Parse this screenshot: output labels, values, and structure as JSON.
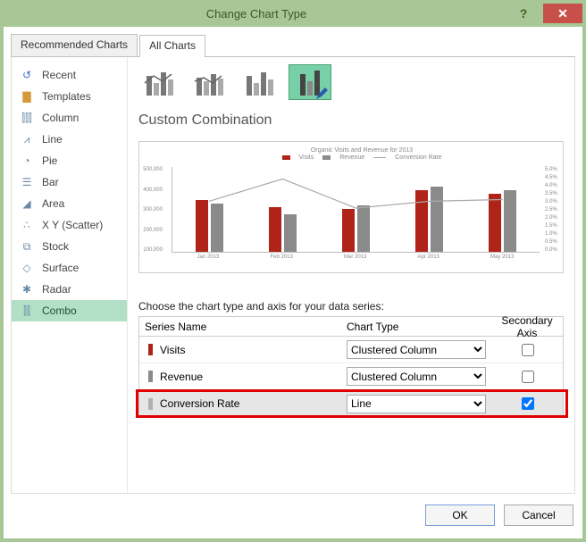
{
  "titlebar": {
    "title": "Change Chart Type"
  },
  "tabs": {
    "recommended": "Recommended Charts",
    "all": "All Charts"
  },
  "sidebar": {
    "items": [
      {
        "label": "Recent"
      },
      {
        "label": "Templates"
      },
      {
        "label": "Column"
      },
      {
        "label": "Line"
      },
      {
        "label": "Pie"
      },
      {
        "label": "Bar"
      },
      {
        "label": "Area"
      },
      {
        "label": "X Y (Scatter)"
      },
      {
        "label": "Stock"
      },
      {
        "label": "Surface"
      },
      {
        "label": "Radar"
      },
      {
        "label": "Combo"
      }
    ]
  },
  "section": {
    "title": "Custom Combination"
  },
  "chart": {
    "title": "Organic Visits and Revenue for 2013",
    "legend": [
      "Visits",
      "Revenue",
      "Conversion Rate"
    ],
    "left_ticks": [
      "500,000",
      "400,000",
      "300,000",
      "200,000",
      "100,000"
    ],
    "right_ticks": [
      "5.0%",
      "4.5%",
      "4.0%",
      "3.5%",
      "3.0%",
      "2.5%",
      "2.0%",
      "1.5%",
      "1.0%",
      "0.5%",
      "0.0%"
    ],
    "categories": [
      "Jan 2013",
      "Feb 2013",
      "Mar 2013",
      "Apr 2013",
      "May 2013"
    ]
  },
  "series": {
    "heading": "Choose the chart type and axis for your data series:",
    "cols": {
      "name": "Series Name",
      "type": "Chart Type",
      "axis": "Secondary Axis"
    },
    "rows": [
      {
        "name": "Visits",
        "type": "Clustered Column",
        "secondary": false,
        "color": "#b02318"
      },
      {
        "name": "Revenue",
        "type": "Clustered Column",
        "secondary": false,
        "color": "#8a8a8a"
      },
      {
        "name": "Conversion Rate",
        "type": "Line",
        "secondary": true,
        "color": "#b0b0b0"
      }
    ]
  },
  "footer": {
    "ok": "OK",
    "cancel": "Cancel"
  },
  "chart_data": {
    "type": "bar",
    "title": "Organic Visits and Revenue for 2013",
    "categories": [
      "Jan 2013",
      "Feb 2013",
      "Mar 2013",
      "Apr 2013",
      "May 2013"
    ],
    "series": [
      {
        "name": "Visits",
        "type": "bar",
        "values": [
          300000,
          260000,
          250000,
          360000,
          340000
        ]
      },
      {
        "name": "Revenue",
        "type": "bar",
        "values": [
          280000,
          220000,
          270000,
          380000,
          360000
        ]
      },
      {
        "name": "Conversion Rate",
        "type": "line",
        "secondary_axis": true,
        "values": [
          3.0,
          4.3,
          2.6,
          3.0,
          3.1
        ]
      }
    ],
    "ylabel_left": "",
    "ylim_left": [
      0,
      500000
    ],
    "ylabel_right": "",
    "ylim_right": [
      0,
      5.0
    ]
  }
}
